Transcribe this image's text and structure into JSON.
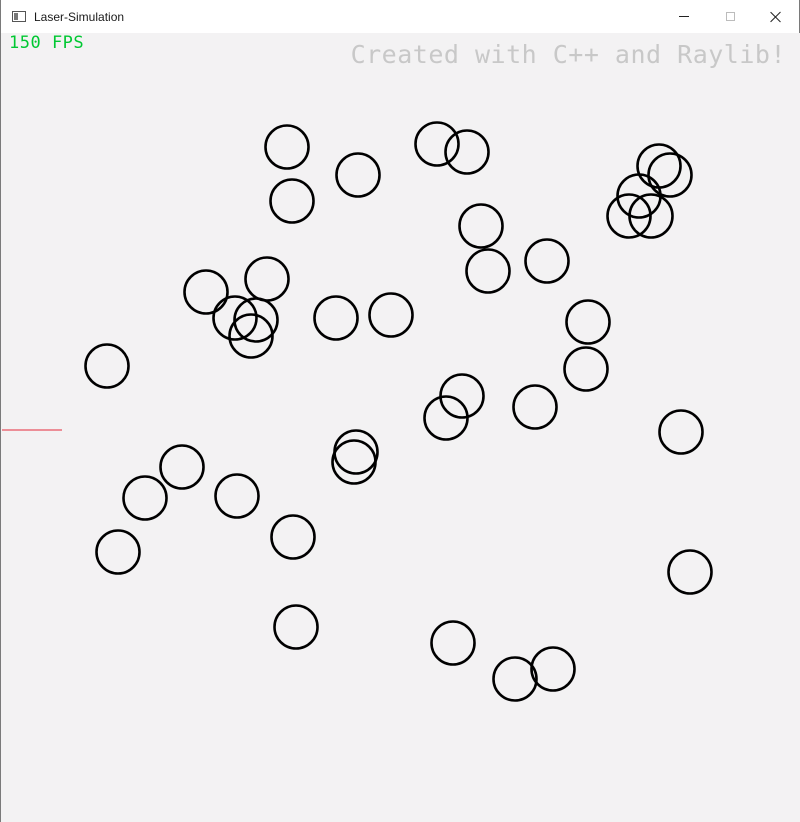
{
  "window": {
    "title": "Laser-Simulation",
    "icon": "app-window-icon",
    "controls": [
      "minimize-icon",
      "maximize-icon",
      "close-icon"
    ]
  },
  "hud": {
    "fps_label": "150 FPS",
    "credit": "Created with C++ and Raylib!"
  },
  "colors": {
    "background": "#f3f2f3",
    "fps": "#00c832",
    "credit": "#c8c8c8",
    "circle_stroke": "#000000",
    "laser": "#e6293b"
  }
}
